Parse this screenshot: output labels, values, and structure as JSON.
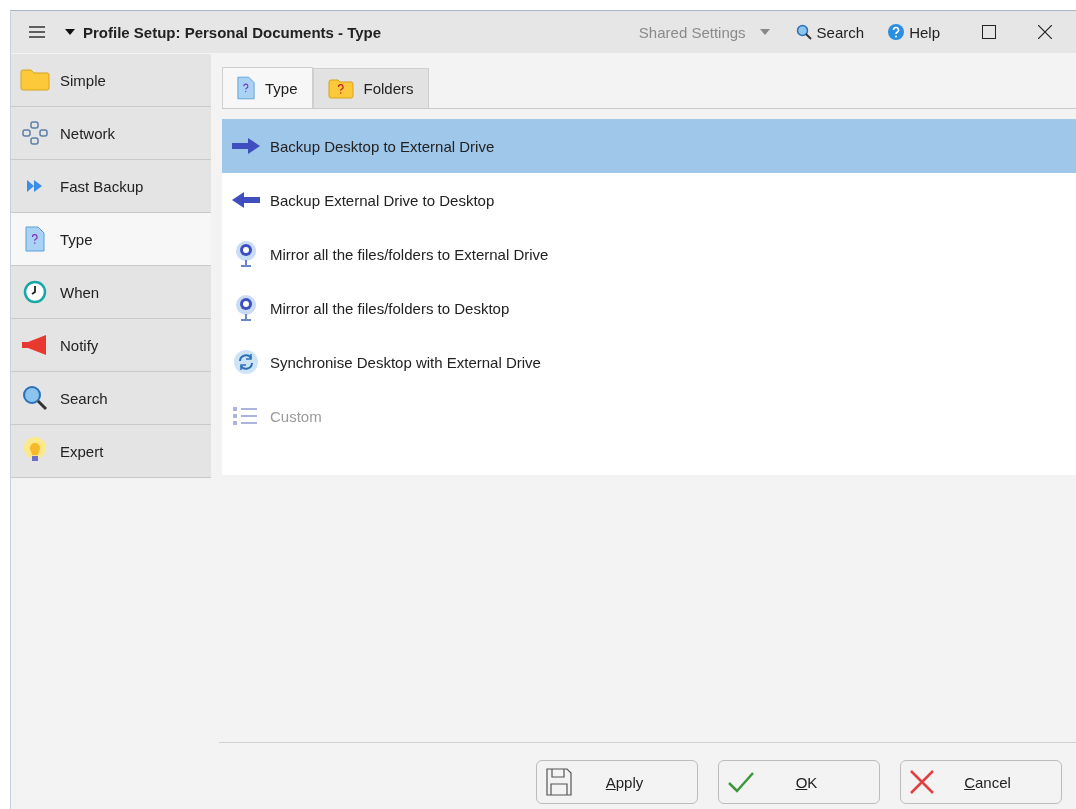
{
  "title_bar": {
    "title": "Profile Setup: Personal Documents - Type",
    "shared_settings": "Shared Settings",
    "search": "Search",
    "help": "Help"
  },
  "sidebar": {
    "items": [
      {
        "label": "Simple",
        "kind": "folder",
        "selected": false
      },
      {
        "label": "Network",
        "kind": "network",
        "selected": false
      },
      {
        "label": "Fast Backup",
        "kind": "fast",
        "selected": false
      },
      {
        "label": "Type",
        "kind": "type",
        "selected": true
      },
      {
        "label": "When",
        "kind": "clock",
        "selected": false
      },
      {
        "label": "Notify",
        "kind": "megaphone",
        "selected": false
      },
      {
        "label": "Search",
        "kind": "search",
        "selected": false
      },
      {
        "label": "Expert",
        "kind": "bulb",
        "selected": false
      }
    ]
  },
  "tabs": [
    {
      "label": "Type",
      "kind": "type",
      "selected": true
    },
    {
      "label": "Folders",
      "kind": "folder",
      "selected": false
    }
  ],
  "types": [
    {
      "label": "Backup Desktop to External Drive",
      "kind": "arrow-right",
      "selected": true,
      "disabled": false
    },
    {
      "label": "Backup External Drive to Desktop",
      "kind": "arrow-left",
      "selected": false,
      "disabled": false
    },
    {
      "label": "Mirror all the files/folders to External Drive",
      "kind": "mirror",
      "selected": false,
      "disabled": false
    },
    {
      "label": "Mirror all the files/folders to Desktop",
      "kind": "mirror",
      "selected": false,
      "disabled": false
    },
    {
      "label": "Synchronise Desktop with External Drive",
      "kind": "sync",
      "selected": false,
      "disabled": false
    },
    {
      "label": "Custom",
      "kind": "list",
      "selected": false,
      "disabled": true
    }
  ],
  "buttons": [
    {
      "kind": "apply",
      "mnemonic": "A",
      "rest": "pply"
    },
    {
      "kind": "ok",
      "mnemonic": "O",
      "rest": "K"
    },
    {
      "kind": "cancel",
      "mnemonic": "C",
      "rest": "ancel"
    }
  ]
}
